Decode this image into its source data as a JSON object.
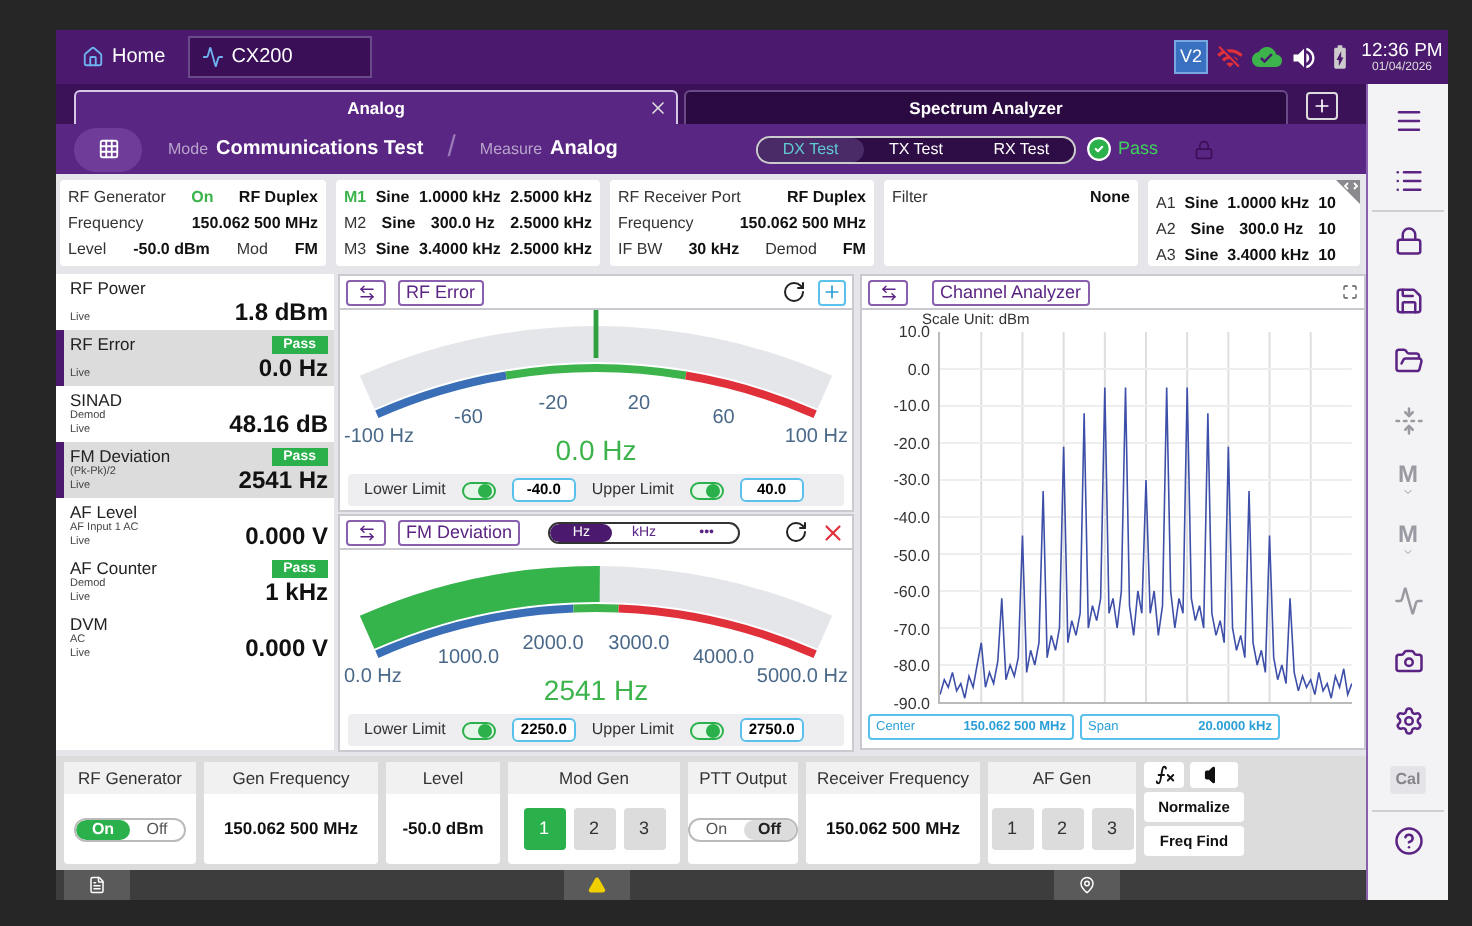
{
  "top_bar": {
    "tabs": [
      {
        "label": "Home",
        "selected": false
      },
      {
        "label": "CX200",
        "selected": true
      }
    ],
    "badge": "V2",
    "time": "12:36 PM",
    "date": "01/04/2026"
  },
  "tabs": [
    {
      "label": "Analog",
      "selected": true,
      "closable": true
    },
    {
      "label": "Spectrum Analyzer",
      "selected": false,
      "closable": false
    }
  ],
  "mode_bar": {
    "mode_label": "Mode",
    "mode": "Communications Test",
    "separator": "/",
    "measure_label": "Measure",
    "measure": "Analog",
    "tests": [
      {
        "label": "DX Test",
        "selected": true
      },
      {
        "label": "TX Test",
        "selected": false
      },
      {
        "label": "RX Test",
        "selected": false
      }
    ],
    "status": "Pass"
  },
  "info_cards": [
    {
      "rows": [
        [
          {
            "kind": "label",
            "text": "RF Generator"
          },
          {
            "kind": "status",
            "text": "On"
          },
          {
            "kind": "value",
            "text": "RF Duplex"
          }
        ],
        [
          {
            "kind": "label",
            "text": "Frequency"
          },
          {
            "kind": "value",
            "text": "150.062 500 MHz"
          }
        ],
        [
          {
            "kind": "label",
            "text": "Level"
          },
          {
            "kind": "value",
            "text": "-50.0 dBm"
          },
          {
            "kind": "label",
            "text": "Mod"
          },
          {
            "kind": "value",
            "text": "FM"
          }
        ]
      ]
    },
    {
      "rows": [
        [
          {
            "kind": "status",
            "text": "M1"
          },
          {
            "kind": "value",
            "text": "Sine"
          },
          {
            "kind": "value",
            "text": "1.0000 kHz"
          },
          {
            "kind": "value",
            "text": "2.5000 kHz"
          }
        ],
        [
          {
            "kind": "label",
            "text": "M2"
          },
          {
            "kind": "value",
            "text": "Sine"
          },
          {
            "kind": "value",
            "text": "300.0 Hz"
          },
          {
            "kind": "value",
            "text": "2.5000 kHz"
          }
        ],
        [
          {
            "kind": "label",
            "text": "M3"
          },
          {
            "kind": "value",
            "text": "Sine"
          },
          {
            "kind": "value",
            "text": "3.4000 kHz"
          },
          {
            "kind": "value",
            "text": "2.5000 kHz"
          }
        ]
      ]
    },
    {
      "rows": [
        [
          {
            "kind": "label",
            "text": "RF Receiver Port"
          },
          {
            "kind": "value",
            "text": "RF Duplex"
          }
        ],
        [
          {
            "kind": "label",
            "text": "Frequency"
          },
          {
            "kind": "value",
            "text": "150.062 500 MHz"
          }
        ],
        [
          {
            "kind": "label",
            "text": "IF BW"
          },
          {
            "kind": "value",
            "text": "30 kHz"
          },
          {
            "kind": "label",
            "text": "Demod"
          },
          {
            "kind": "value",
            "text": "FM"
          }
        ]
      ]
    },
    {
      "rows": [
        [
          {
            "kind": "label",
            "text": "Filter"
          },
          {
            "kind": "value",
            "text": "None"
          }
        ]
      ]
    },
    {
      "rows": [
        [
          {
            "kind": "label",
            "text": "A1"
          },
          {
            "kind": "value",
            "text": "Sine"
          },
          {
            "kind": "value",
            "text": "1.0000 kHz"
          },
          {
            "kind": "value",
            "text": "10"
          }
        ],
        [
          {
            "kind": "label",
            "text": "A2"
          },
          {
            "kind": "value",
            "text": "Sine"
          },
          {
            "kind": "value",
            "text": "300.0 Hz"
          },
          {
            "kind": "value",
            "text": "10"
          }
        ],
        [
          {
            "kind": "label",
            "text": "A3"
          },
          {
            "kind": "value",
            "text": "Sine"
          },
          {
            "kind": "value",
            "text": "3.4000 kHz"
          },
          {
            "kind": "value",
            "text": "10"
          }
        ]
      ]
    }
  ],
  "measurements": [
    {
      "name": "RF Power",
      "details": [
        "Live"
      ],
      "value": "1.8 dBm",
      "selected": false
    },
    {
      "name": "RF Error",
      "details": [
        "Live"
      ],
      "value": "0.0 Hz",
      "badge": "Pass",
      "selected": true
    },
    {
      "name": "SINAD",
      "details": [
        "Demod",
        "Live"
      ],
      "value": "48.16 dB",
      "selected": false
    },
    {
      "name": "FM Deviation",
      "details": [
        "(Pk-Pk)/2",
        "Live"
      ],
      "value": "2541 Hz",
      "badge": "Pass",
      "selected": true
    },
    {
      "name": "AF Level",
      "details": [
        "AF Input 1 AC",
        "Live"
      ],
      "value": "0.000 V",
      "selected": false
    },
    {
      "name": "AF Counter",
      "details": [
        "Demod",
        "Live"
      ],
      "value": "1 kHz",
      "badge": "Pass",
      "selected": false
    },
    {
      "name": "DVM",
      "details": [
        "AC",
        "Live"
      ],
      "value": "0.000 V",
      "selected": false
    }
  ],
  "gauges": [
    {
      "title": "RF Error",
      "kind": "needle",
      "corner_button": {
        "kind": "add"
      },
      "scale": [
        "-60",
        "-20",
        "20",
        "60"
      ],
      "min": "-100 Hz",
      "max": "100 Hz",
      "reading": "0.0 Hz",
      "level": 0.5,
      "limits": [
        {
          "label": "Lower Limit",
          "on": true,
          "value": "-40.0"
        },
        {
          "label": "Upper Limit",
          "on": true,
          "value": "40.0"
        }
      ]
    },
    {
      "title": "FM Deviation",
      "kind": "fill",
      "corner_button": {
        "kind": "close"
      },
      "units": [
        {
          "label": "Hz",
          "selected": true
        },
        {
          "label": "kHz",
          "selected": false
        },
        {
          "label": "•••",
          "selected": false
        }
      ],
      "scale": [
        "1000.0",
        "2000.0",
        "3000.0",
        "4000.0"
      ],
      "min": "0.0 Hz",
      "max": "5000.0 Hz",
      "reading": "2541 Hz",
      "level": 0.508,
      "limits": [
        {
          "label": "Lower Limit",
          "on": true,
          "value": "2250.0"
        },
        {
          "label": "Upper Limit",
          "on": true,
          "value": "2750.0"
        }
      ]
    }
  ],
  "spectrum": {
    "title": "Channel Analyzer",
    "scale_unit": "Scale Unit: dBm",
    "chart_data": {
      "type": "line",
      "grid": true,
      "ylim": [
        -90,
        10
      ],
      "yticks": [
        {
          "value": 10,
          "label": "10.0"
        },
        {
          "value": 0,
          "label": "0.0"
        },
        {
          "value": -10,
          "label": "-10.0"
        },
        {
          "value": -20,
          "label": "-20.0"
        },
        {
          "value": -30,
          "label": "-30.0"
        },
        {
          "value": -40,
          "label": "-40.0"
        },
        {
          "value": -50,
          "label": "-50.0"
        },
        {
          "value": -60,
          "label": "-60.0"
        },
        {
          "value": -70,
          "label": "-70.0"
        },
        {
          "value": -80,
          "label": "-80.0"
        },
        {
          "value": -90,
          "label": "-90.0"
        }
      ],
      "series": [
        {
          "color": "#3d4fa8",
          "values": [
            -88,
            -84,
            -86,
            -82,
            -87,
            -85,
            -89,
            -83,
            -86,
            -80,
            -74,
            -86,
            -82,
            -85,
            -79,
            -62,
            -84,
            -80,
            -83,
            -78,
            -45,
            -82,
            -76,
            -80,
            -74,
            -33,
            -78,
            -72,
            -76,
            -70,
            -21,
            -74,
            -68,
            -72,
            -66,
            -12,
            -70,
            -64,
            -68,
            -62,
            -5,
            -66,
            -62,
            -70,
            -60,
            -5,
            -64,
            -72,
            -60,
            -66,
            -30,
            -66,
            -60,
            -72,
            -64,
            -5,
            -60,
            -70,
            -62,
            -66,
            -5,
            -62,
            -68,
            -64,
            -70,
            -12,
            -66,
            -72,
            -68,
            -74,
            -21,
            -70,
            -76,
            -72,
            -78,
            -33,
            -74,
            -80,
            -76,
            -82,
            -45,
            -78,
            -84,
            -80,
            -85,
            -62,
            -82,
            -87,
            -83,
            -86,
            -84,
            -88,
            -82,
            -87,
            -85,
            -89,
            -83,
            -86,
            -81,
            -88,
            -85
          ]
        }
      ]
    },
    "center_label": "Center",
    "center": "150.062 500 MHz",
    "span_label": "Span",
    "span": "20.0000 kHz"
  },
  "controls": [
    {
      "kind": "toggle",
      "title": "RF Generator",
      "options": [
        {
          "label": "On",
          "selected": true
        },
        {
          "label": "Off",
          "selected": false
        }
      ]
    },
    {
      "kind": "value",
      "title": "Gen Frequency",
      "value": "150.062 500 MHz"
    },
    {
      "kind": "value",
      "title": "Level",
      "value": "-50.0 dBm"
    },
    {
      "kind": "buttons",
      "title": "Mod Gen",
      "options": [
        {
          "label": "1",
          "selected": true
        },
        {
          "label": "2",
          "selected": false
        },
        {
          "label": "3",
          "selected": false
        }
      ]
    },
    {
      "kind": "toggle",
      "title": "PTT Output",
      "options": [
        {
          "label": "On",
          "selected": false
        },
        {
          "label": "Off",
          "selected": true
        }
      ]
    },
    {
      "kind": "value",
      "title": "Receiver Frequency",
      "value": "150.062 500 MHz"
    },
    {
      "kind": "buttons",
      "title": "AF Gen",
      "options": [
        {
          "label": "1",
          "selected": false
        },
        {
          "label": "2",
          "selected": false
        },
        {
          "label": "3",
          "selected": false
        }
      ]
    }
  ],
  "tool_buttons": [
    "Normalize",
    "Freq Find"
  ],
  "side_toolbar": [
    {
      "kind": "icon",
      "disabled": false
    },
    {
      "kind": "icon",
      "disabled": false
    },
    {
      "kind": "icon",
      "disabled": false
    },
    {
      "kind": "icon",
      "disabled": false
    },
    {
      "kind": "icon",
      "disabled": false
    },
    {
      "kind": "icon",
      "disabled": true
    },
    {
      "kind": "marker",
      "label": "M",
      "disabled": true
    },
    {
      "kind": "marker",
      "label": "M",
      "disabled": true
    },
    {
      "kind": "icon",
      "disabled": true
    },
    {
      "kind": "icon",
      "disabled": false
    },
    {
      "kind": "icon",
      "disabled": false
    },
    {
      "kind": "text",
      "label": "Cal",
      "disabled": true
    },
    {
      "kind": "icon",
      "disabled": false
    }
  ]
}
